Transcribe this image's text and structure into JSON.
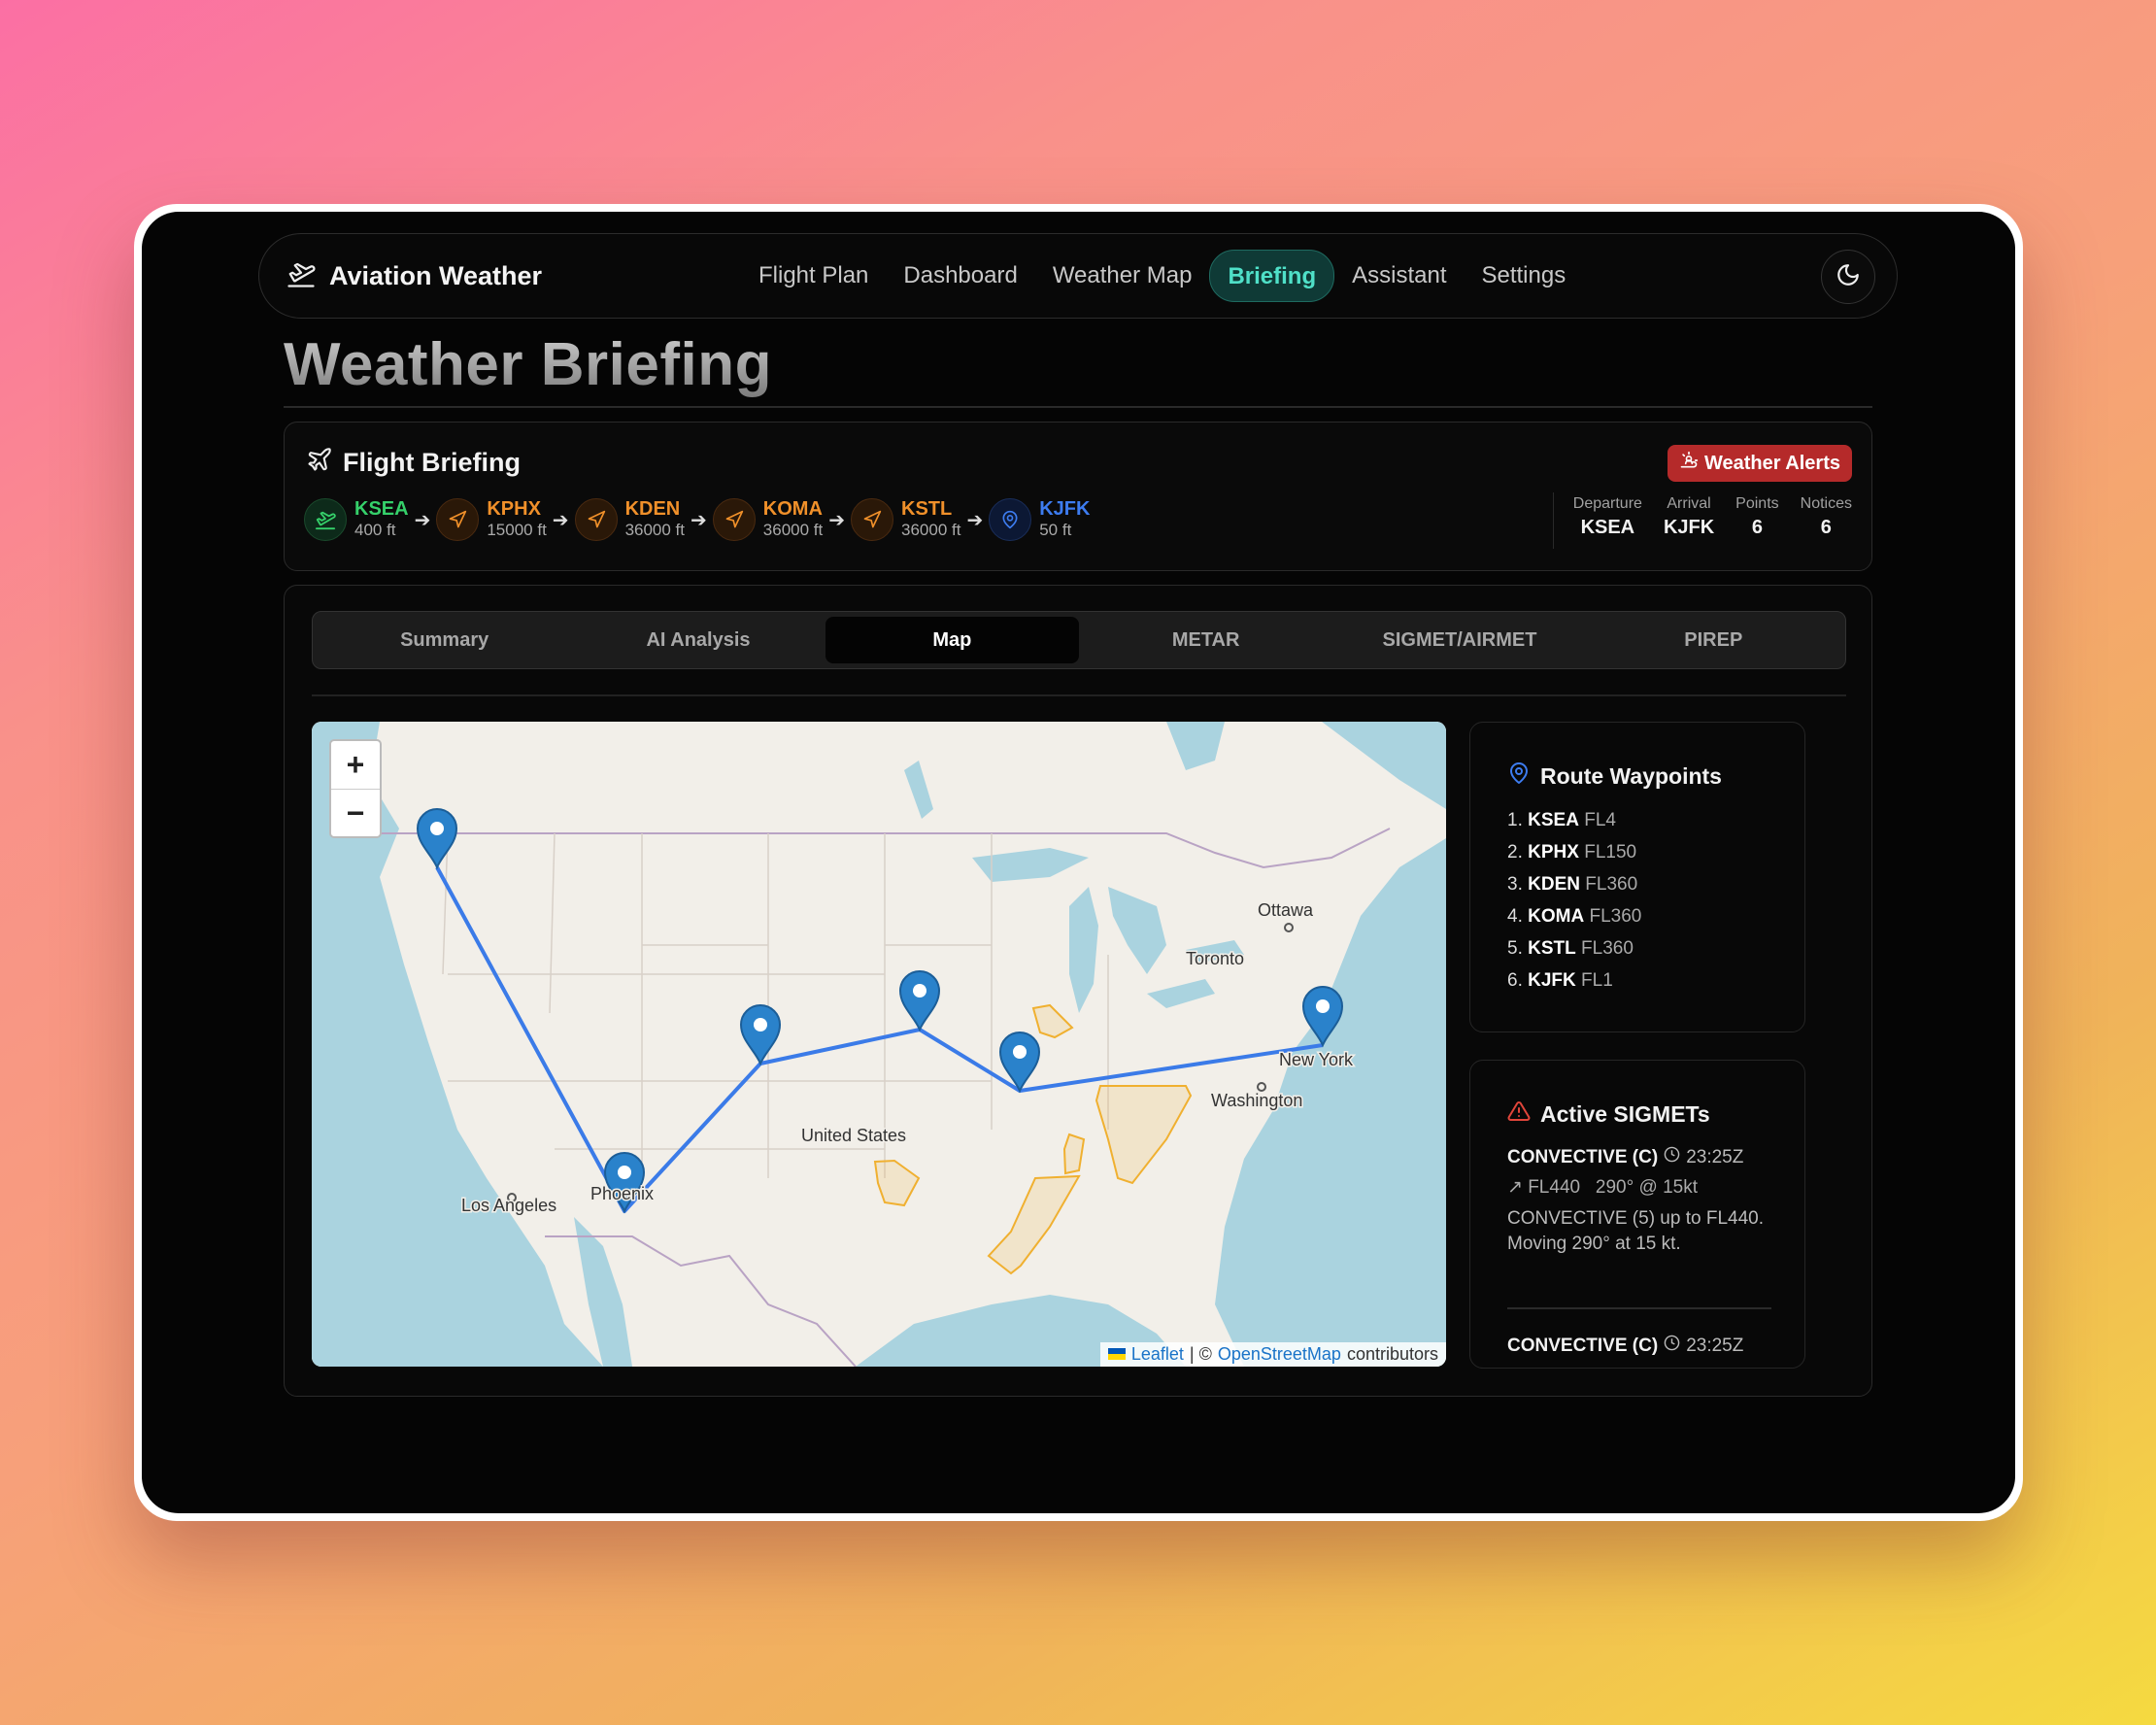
{
  "app": {
    "brand": "Aviation Weather",
    "nav": [
      "Flight Plan",
      "Dashboard",
      "Weather Map",
      "Briefing",
      "Assistant",
      "Settings"
    ],
    "active_nav": "Briefing"
  },
  "page_title": "Weather Briefing",
  "briefing": {
    "title": "Flight Briefing",
    "alert_label": "Weather Alerts",
    "route": [
      {
        "code": "KSEA",
        "alt": "400 ft",
        "type": "departure",
        "color": "#35d06a"
      },
      {
        "code": "KPHX",
        "alt": "15000 ft",
        "type": "waypoint",
        "color": "#f0902a"
      },
      {
        "code": "KDEN",
        "alt": "36000 ft",
        "type": "waypoint",
        "color": "#f0902a"
      },
      {
        "code": "KOMA",
        "alt": "36000 ft",
        "type": "waypoint",
        "color": "#f0902a"
      },
      {
        "code": "KSTL",
        "alt": "36000 ft",
        "type": "waypoint",
        "color": "#f0902a"
      },
      {
        "code": "KJFK",
        "alt": "50 ft",
        "type": "arrival",
        "color": "#3d7cf0"
      }
    ],
    "stats": [
      {
        "label": "Departure",
        "value": "KSEA"
      },
      {
        "label": "Arrival",
        "value": "KJFK"
      },
      {
        "label": "Points",
        "value": "6"
      },
      {
        "label": "Notices",
        "value": "6"
      }
    ]
  },
  "tabs": [
    "Summary",
    "AI Analysis",
    "Map",
    "METAR",
    "SIGMET/AIRMET",
    "PIREP"
  ],
  "active_tab": "Map",
  "map": {
    "labels": [
      "Ottawa",
      "Toronto",
      "New York",
      "Washington",
      "United States",
      "Los Angeles",
      "Phoenix"
    ],
    "attribution": {
      "leaflet": "Leaflet",
      "sep": "| ©",
      "osm": "OpenStreetMap",
      "suffix": "contributors"
    }
  },
  "waypoints_panel": {
    "title": "Route Waypoints",
    "items": [
      {
        "n": "1.",
        "code": "KSEA",
        "fl": "FL4"
      },
      {
        "n": "2.",
        "code": "KPHX",
        "fl": "FL150"
      },
      {
        "n": "3.",
        "code": "KDEN",
        "fl": "FL360"
      },
      {
        "n": "4.",
        "code": "KOMA",
        "fl": "FL360"
      },
      {
        "n": "5.",
        "code": "KSTL",
        "fl": "FL360"
      },
      {
        "n": "6.",
        "code": "KJFK",
        "fl": "FL1"
      }
    ]
  },
  "sigmets_panel": {
    "title": "Active SIGMETs",
    "items": [
      {
        "type": "CONVECTIVE (C)",
        "time": "23:25Z",
        "level": "FL440",
        "movement": "290° @ 15kt",
        "text": "CONVECTIVE (5) up to FL440. Moving 290° at 15 kt."
      },
      {
        "type": "CONVECTIVE (C)",
        "time": "23:25Z"
      }
    ]
  }
}
